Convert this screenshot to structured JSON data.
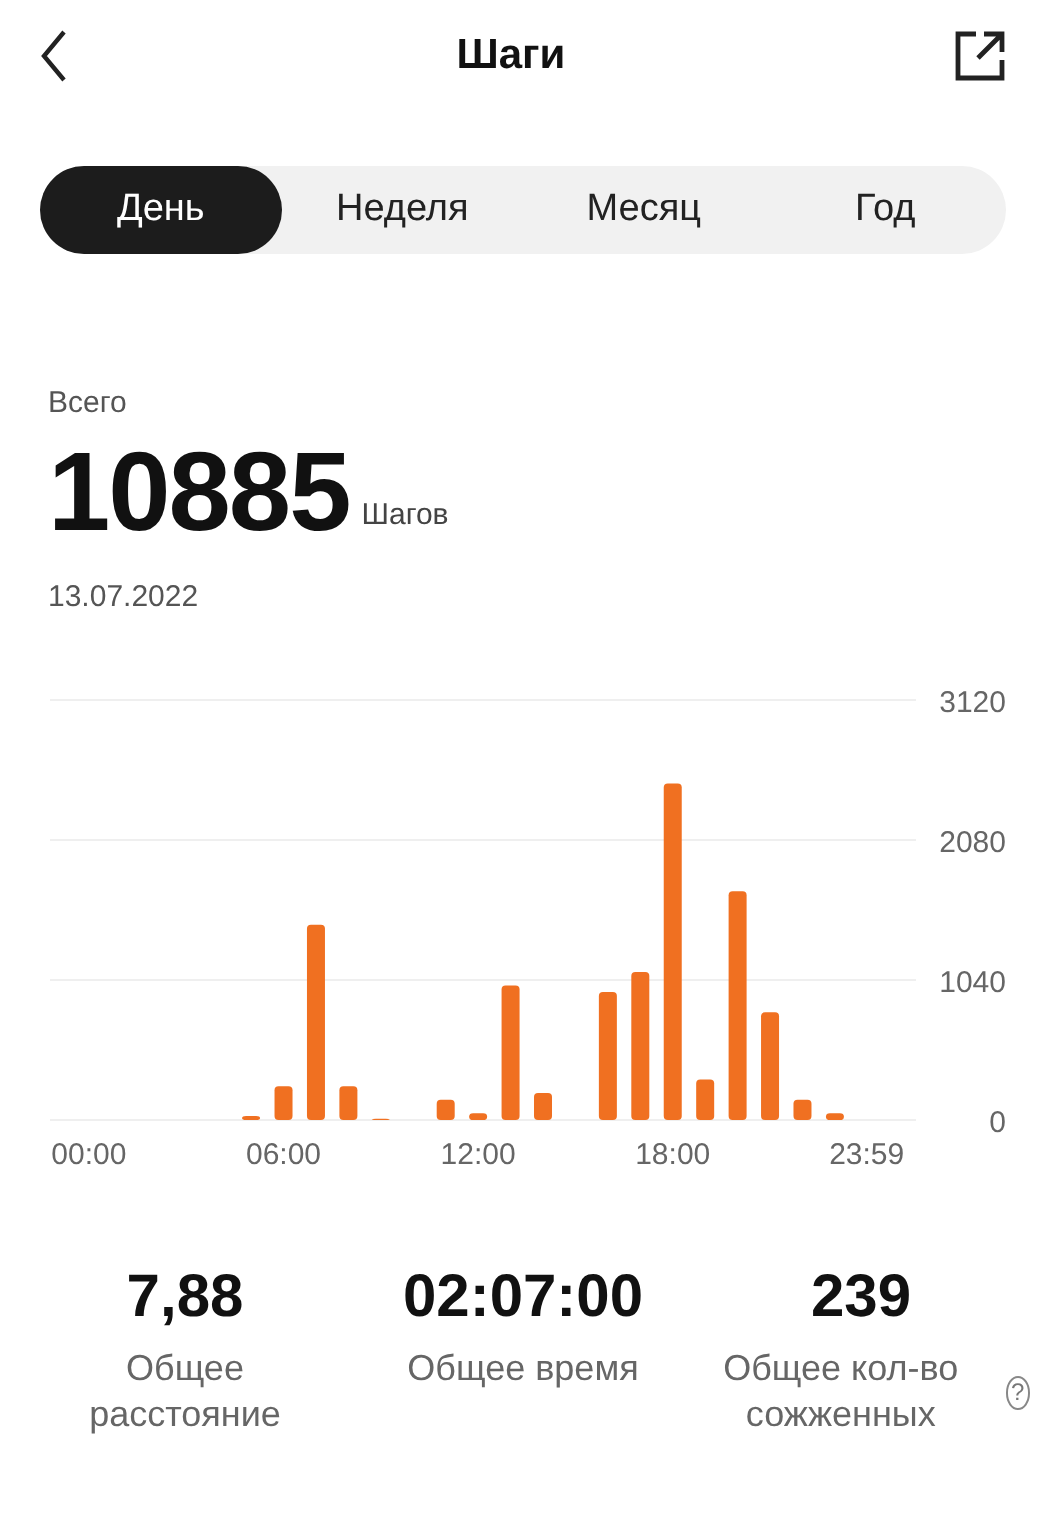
{
  "header": {
    "title": "Шаги"
  },
  "tabs": [
    {
      "label": "День",
      "selected": true
    },
    {
      "label": "Неделя",
      "selected": false
    },
    {
      "label": "Месяц",
      "selected": false
    },
    {
      "label": "Год",
      "selected": false
    }
  ],
  "summary": {
    "caption": "Всего",
    "value": "10885",
    "unit": "Шагов",
    "date": "13.07.2022"
  },
  "chart_data": {
    "type": "bar",
    "x": [
      0,
      1,
      2,
      3,
      4,
      5,
      6,
      7,
      8,
      9,
      10,
      11,
      12,
      13,
      14,
      15,
      16,
      17,
      18,
      19,
      20,
      21,
      22,
      23
    ],
    "series": [
      {
        "color": "#f07021",
        "values": [
          0,
          0,
          0,
          0,
          0,
          30,
          250,
          1450,
          250,
          10,
          0,
          150,
          50,
          1000,
          200,
          0,
          950,
          1100,
          2500,
          300,
          1700,
          800,
          150,
          50
        ]
      }
    ],
    "xlim": [
      -1.2,
      25.5
    ],
    "ylim": [
      0,
      3120
    ],
    "yticks": [
      0,
      1040,
      2080,
      3120
    ],
    "xticks": [
      {
        "value": 0,
        "label": "00:00"
      },
      {
        "value": 6,
        "label": "06:00"
      },
      {
        "value": 12,
        "label": "12:00"
      },
      {
        "value": 18,
        "label": "18:00"
      },
      {
        "value": 23.98,
        "label": "23:59"
      }
    ]
  },
  "stats": [
    {
      "value": "7,88",
      "label": "Общее расстояние"
    },
    {
      "value": "02:07:00",
      "label": "Общее время"
    },
    {
      "value": "239",
      "label": "Общее кол-во сожженных",
      "help_icon": "?"
    }
  ]
}
